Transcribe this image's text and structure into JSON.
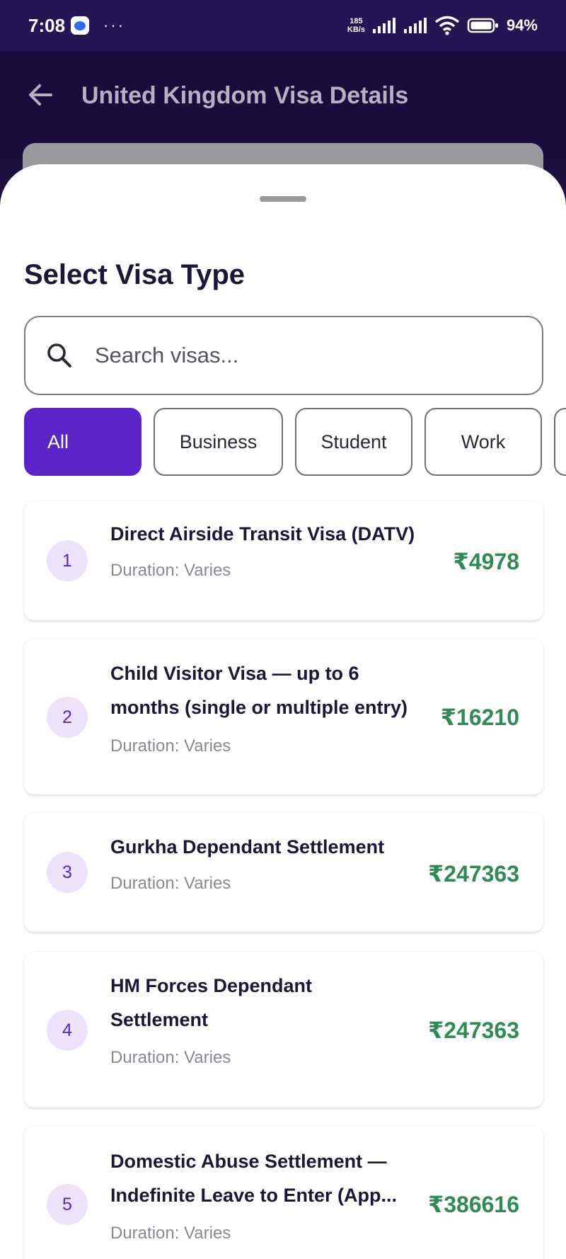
{
  "status_bar": {
    "time": "7:08",
    "more": "···",
    "net_speed_value": "185",
    "net_speed_unit": "KB/s",
    "battery": "94%"
  },
  "header": {
    "title": "United Kingdom Visa Details",
    "back_icon": "arrow-left-icon"
  },
  "sheet": {
    "title": "Select Visa Type",
    "search": {
      "placeholder": "Search visas...",
      "value": "",
      "icon": "search-icon"
    },
    "filters": [
      {
        "label": "All",
        "selected": true
      },
      {
        "label": "Business",
        "selected": false
      },
      {
        "label": "Student",
        "selected": false
      },
      {
        "label": "Work",
        "selected": false
      }
    ],
    "visas": [
      {
        "number": "1",
        "name": "Direct Airside Transit Visa (DATV)",
        "duration": "Duration: Varies",
        "price": "₹4978"
      },
      {
        "number": "2",
        "name": "Child Visitor Visa — up to 6 months (single or multiple entry)",
        "duration": "Duration: Varies",
        "price": "₹16210"
      },
      {
        "number": "3",
        "name": "Gurkha Dependant Settlement",
        "duration": "Duration: Varies",
        "price": "₹247363"
      },
      {
        "number": "4",
        "name": "HM Forces Dependant Settlement",
        "duration": "Duration: Varies",
        "price": "₹247363"
      },
      {
        "number": "5",
        "name_line1": "Domestic Abuse Settlement —",
        "name_line2": "Indefinite Leave to Enter (App...",
        "duration": "Duration: Varies",
        "price": "₹386616"
      }
    ]
  },
  "colors": {
    "accent": "#5b24c9",
    "price": "#2f8a55",
    "header_bg": "#1a0c3c",
    "status_bg": "#241554",
    "badge_bg": "#ece3fb"
  }
}
